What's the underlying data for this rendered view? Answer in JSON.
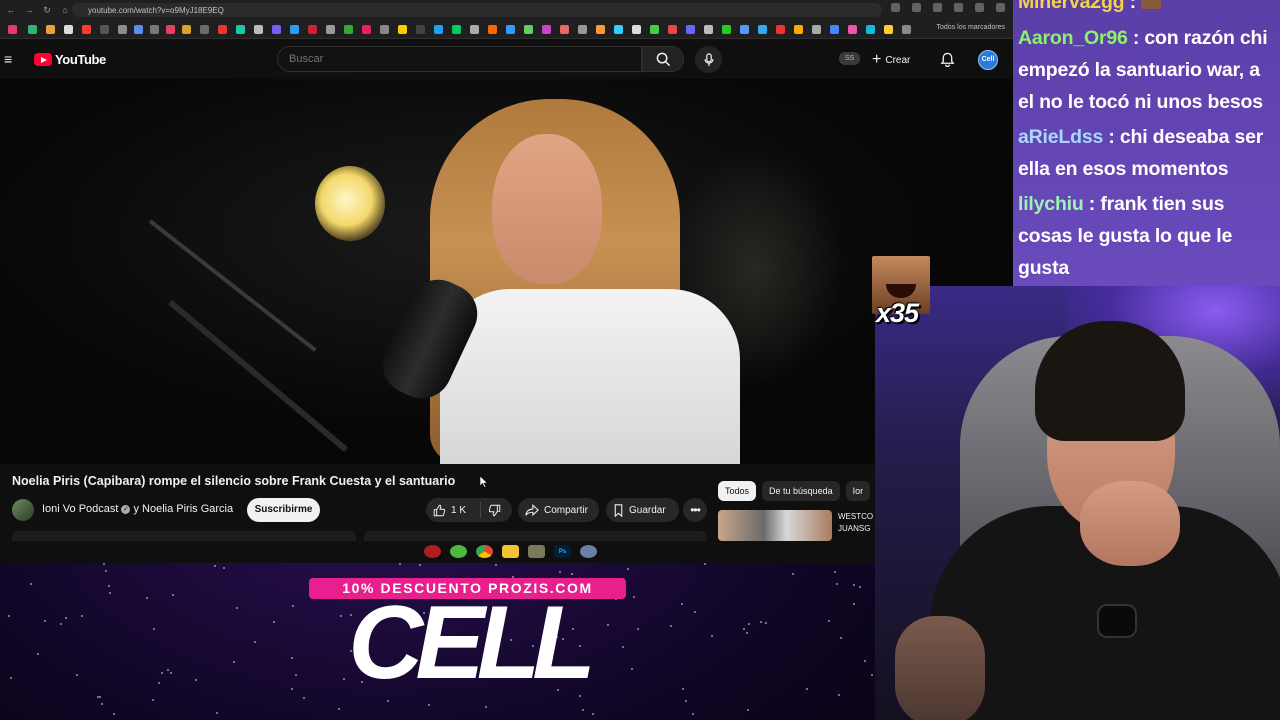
{
  "browser": {
    "url": "youtube.com/watch?v=o9MyJ18E9EQ",
    "all_bookmarks_label": "Todos los marcadores"
  },
  "youtube": {
    "logo_text": "YouTube",
    "search_placeholder": "Buscar",
    "ss_badge": "SS",
    "create_label": "Crear",
    "avatar_text": "Cell"
  },
  "video": {
    "title": "Noelia Piris (Capibara) rompe el silencio sobre Frank Cuesta y el santuario",
    "channel": "Ioni Vo Podcast",
    "verified_mark": "✓",
    "collaborator": "y Noelia Piris Garcia",
    "subscribe_label": "Suscribirme",
    "likes": "1 K",
    "share_label": "Compartir",
    "save_label": "Guardar"
  },
  "sidebar": {
    "chips": [
      "Todos",
      "De tu búsqueda",
      "Ior"
    ],
    "recommended_title_line1": "WESTCO",
    "recommended_title_line2": "JUANSG"
  },
  "chat": {
    "messages": [
      {
        "user": "Minerva2gg",
        "user_color": "#f2d44a",
        "text": " :"
      },
      {
        "user": "Aaron_Or96",
        "user_color": "#8df26b",
        "text": " : con razón chi"
      },
      {
        "user": "",
        "user_color": "#ffffff",
        "text": "empezó la santuario war, a"
      },
      {
        "user": "",
        "user_color": "#ffffff",
        "text": "el no le tocó ni unos besos"
      },
      {
        "user": "aRieLdss",
        "user_color": "#a8d8ff",
        "text": " : chi deseaba ser"
      },
      {
        "user": "",
        "user_color": "#ffffff",
        "text": "ella en esos momentos"
      },
      {
        "user": "lilychiu",
        "user_color": "#9ef0b8",
        "text": " : frank tien sus"
      },
      {
        "user": "",
        "user_color": "#ffffff",
        "text": "cosas le gusta lo que le"
      },
      {
        "user": "",
        "user_color": "#ffffff",
        "text": "gusta"
      }
    ]
  },
  "overlay": {
    "emote_count": "x35",
    "promo_banner": "10% DESCUENTO PROZIS.COM",
    "promo_code": "CELL"
  },
  "colors": {
    "youtube_red": "#ff0033",
    "chat_bg": "#5b3fa8",
    "promo_pink": "#e81f8c"
  }
}
